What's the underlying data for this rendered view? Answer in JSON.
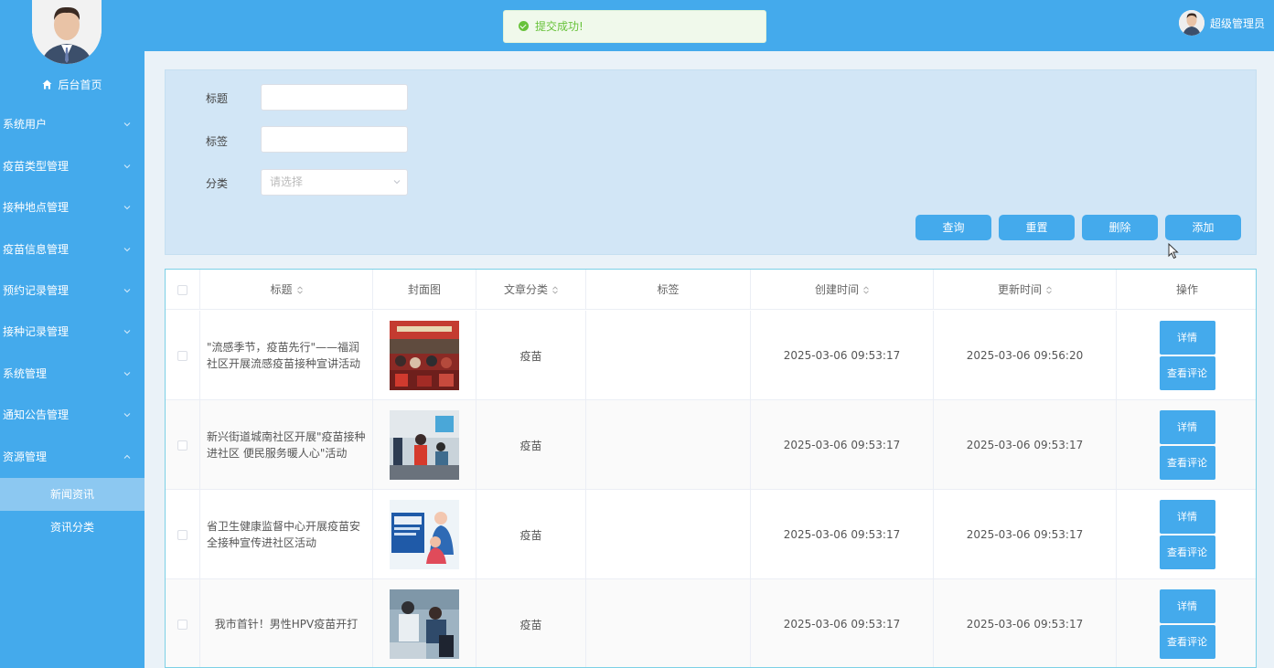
{
  "sidebar": {
    "home_label": "后台首页",
    "menu": [
      {
        "label": "系统用户"
      },
      {
        "label": "疫苗类型管理"
      },
      {
        "label": "接种地点管理"
      },
      {
        "label": "疫苗信息管理"
      },
      {
        "label": "预约记录管理"
      },
      {
        "label": "接种记录管理"
      },
      {
        "label": "系统管理"
      },
      {
        "label": "通知公告管理"
      },
      {
        "label": "资源管理"
      }
    ],
    "submenu": [
      {
        "label": "新闻资讯",
        "active": true
      },
      {
        "label": "资讯分类",
        "active": false
      }
    ]
  },
  "header": {
    "toast": "提交成功!",
    "user_name": "超级管理员"
  },
  "search": {
    "title_label": "标题",
    "tag_label": "标签",
    "category_label": "分类",
    "category_placeholder": "请选择",
    "buttons": {
      "query": "查询",
      "reset": "重置",
      "delete": "删除",
      "add": "添加"
    }
  },
  "table": {
    "headers": {
      "title": "标题",
      "cover": "封面图",
      "category": "文章分类",
      "tags": "标签",
      "created": "创建时间",
      "updated": "更新时间",
      "actions": "操作"
    },
    "rows": [
      {
        "title": "\"流感季节，疫苗先行\"——福润社区开展流感疫苗接种宣讲活动",
        "category": "疫苗",
        "tags": "",
        "created": "2025-03-06 09:53:17",
        "updated": "2025-03-06 09:56:20",
        "detail": "详情",
        "comments": "查看评论"
      },
      {
        "title": "新兴街道城南社区开展\"疫苗接种进社区 便民服务暖人心\"活动",
        "category": "疫苗",
        "tags": "",
        "created": "2025-03-06 09:53:17",
        "updated": "2025-03-06 09:53:17",
        "detail": "详情",
        "comments": "查看评论"
      },
      {
        "title": "省卫生健康监督中心开展疫苗安全接种宣传进社区活动",
        "category": "疫苗",
        "tags": "",
        "created": "2025-03-06 09:53:17",
        "updated": "2025-03-06 09:53:17",
        "detail": "详情",
        "comments": "查看评论"
      },
      {
        "title": "我市首针！男性HPV疫苗开打",
        "category": "疫苗",
        "tags": "",
        "created": "2025-03-06 09:53:17",
        "updated": "2025-03-06 09:53:17",
        "detail": "详情",
        "comments": "查看评论"
      }
    ]
  },
  "colors": {
    "primary": "#44aaec",
    "panel": "#d2e6f6",
    "success": "#67c23a"
  }
}
